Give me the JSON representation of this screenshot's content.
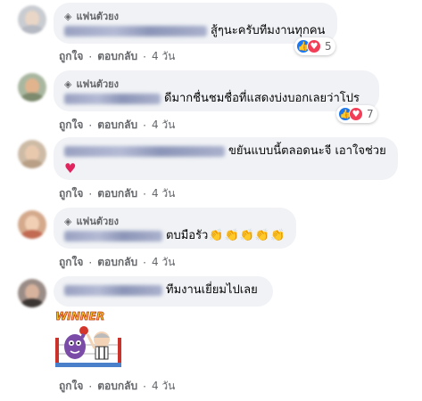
{
  "fan_label": "แฟนตัวยง",
  "actions": {
    "like": "ถูกใจ",
    "reply": "ตอบกลับ",
    "separator": "·"
  },
  "comments": [
    {
      "fan": true,
      "text": "สู้ๆนะครับทีมงานทุกคน",
      "time": "4 วัน",
      "reactions": {
        "icons": [
          "like-icon",
          "love-icon"
        ],
        "count": "5"
      }
    },
    {
      "fan": true,
      "text": "ดีมากชื่นชมชื่อที่แสดงบ่งบอกเลยว่าโปร",
      "time": "4 วัน",
      "reactions": {
        "icons": [
          "like-icon",
          "love-icon"
        ],
        "count": "7"
      }
    },
    {
      "fan": false,
      "text": "ขยันแบบนี้ตลอดนะจี เอาใจช่วย",
      "extra": "♥",
      "time": "4 วัน"
    },
    {
      "fan": true,
      "text": "ตบมือรัว",
      "emoji": "clapping-hands-icon ×5",
      "time": "4 วัน"
    },
    {
      "fan": false,
      "text": "ทีมงานเยี่ยมไปเลย",
      "sticker": {
        "text": "WINNER",
        "icon": "boxing-winner-sticker"
      },
      "time": "4 วัน"
    }
  ],
  "colors": {
    "bubble": "#f0f2f5",
    "secondary_text": "#65676b",
    "like": "#1877f2",
    "love": "#f33e58",
    "heart": "#e0245e"
  }
}
